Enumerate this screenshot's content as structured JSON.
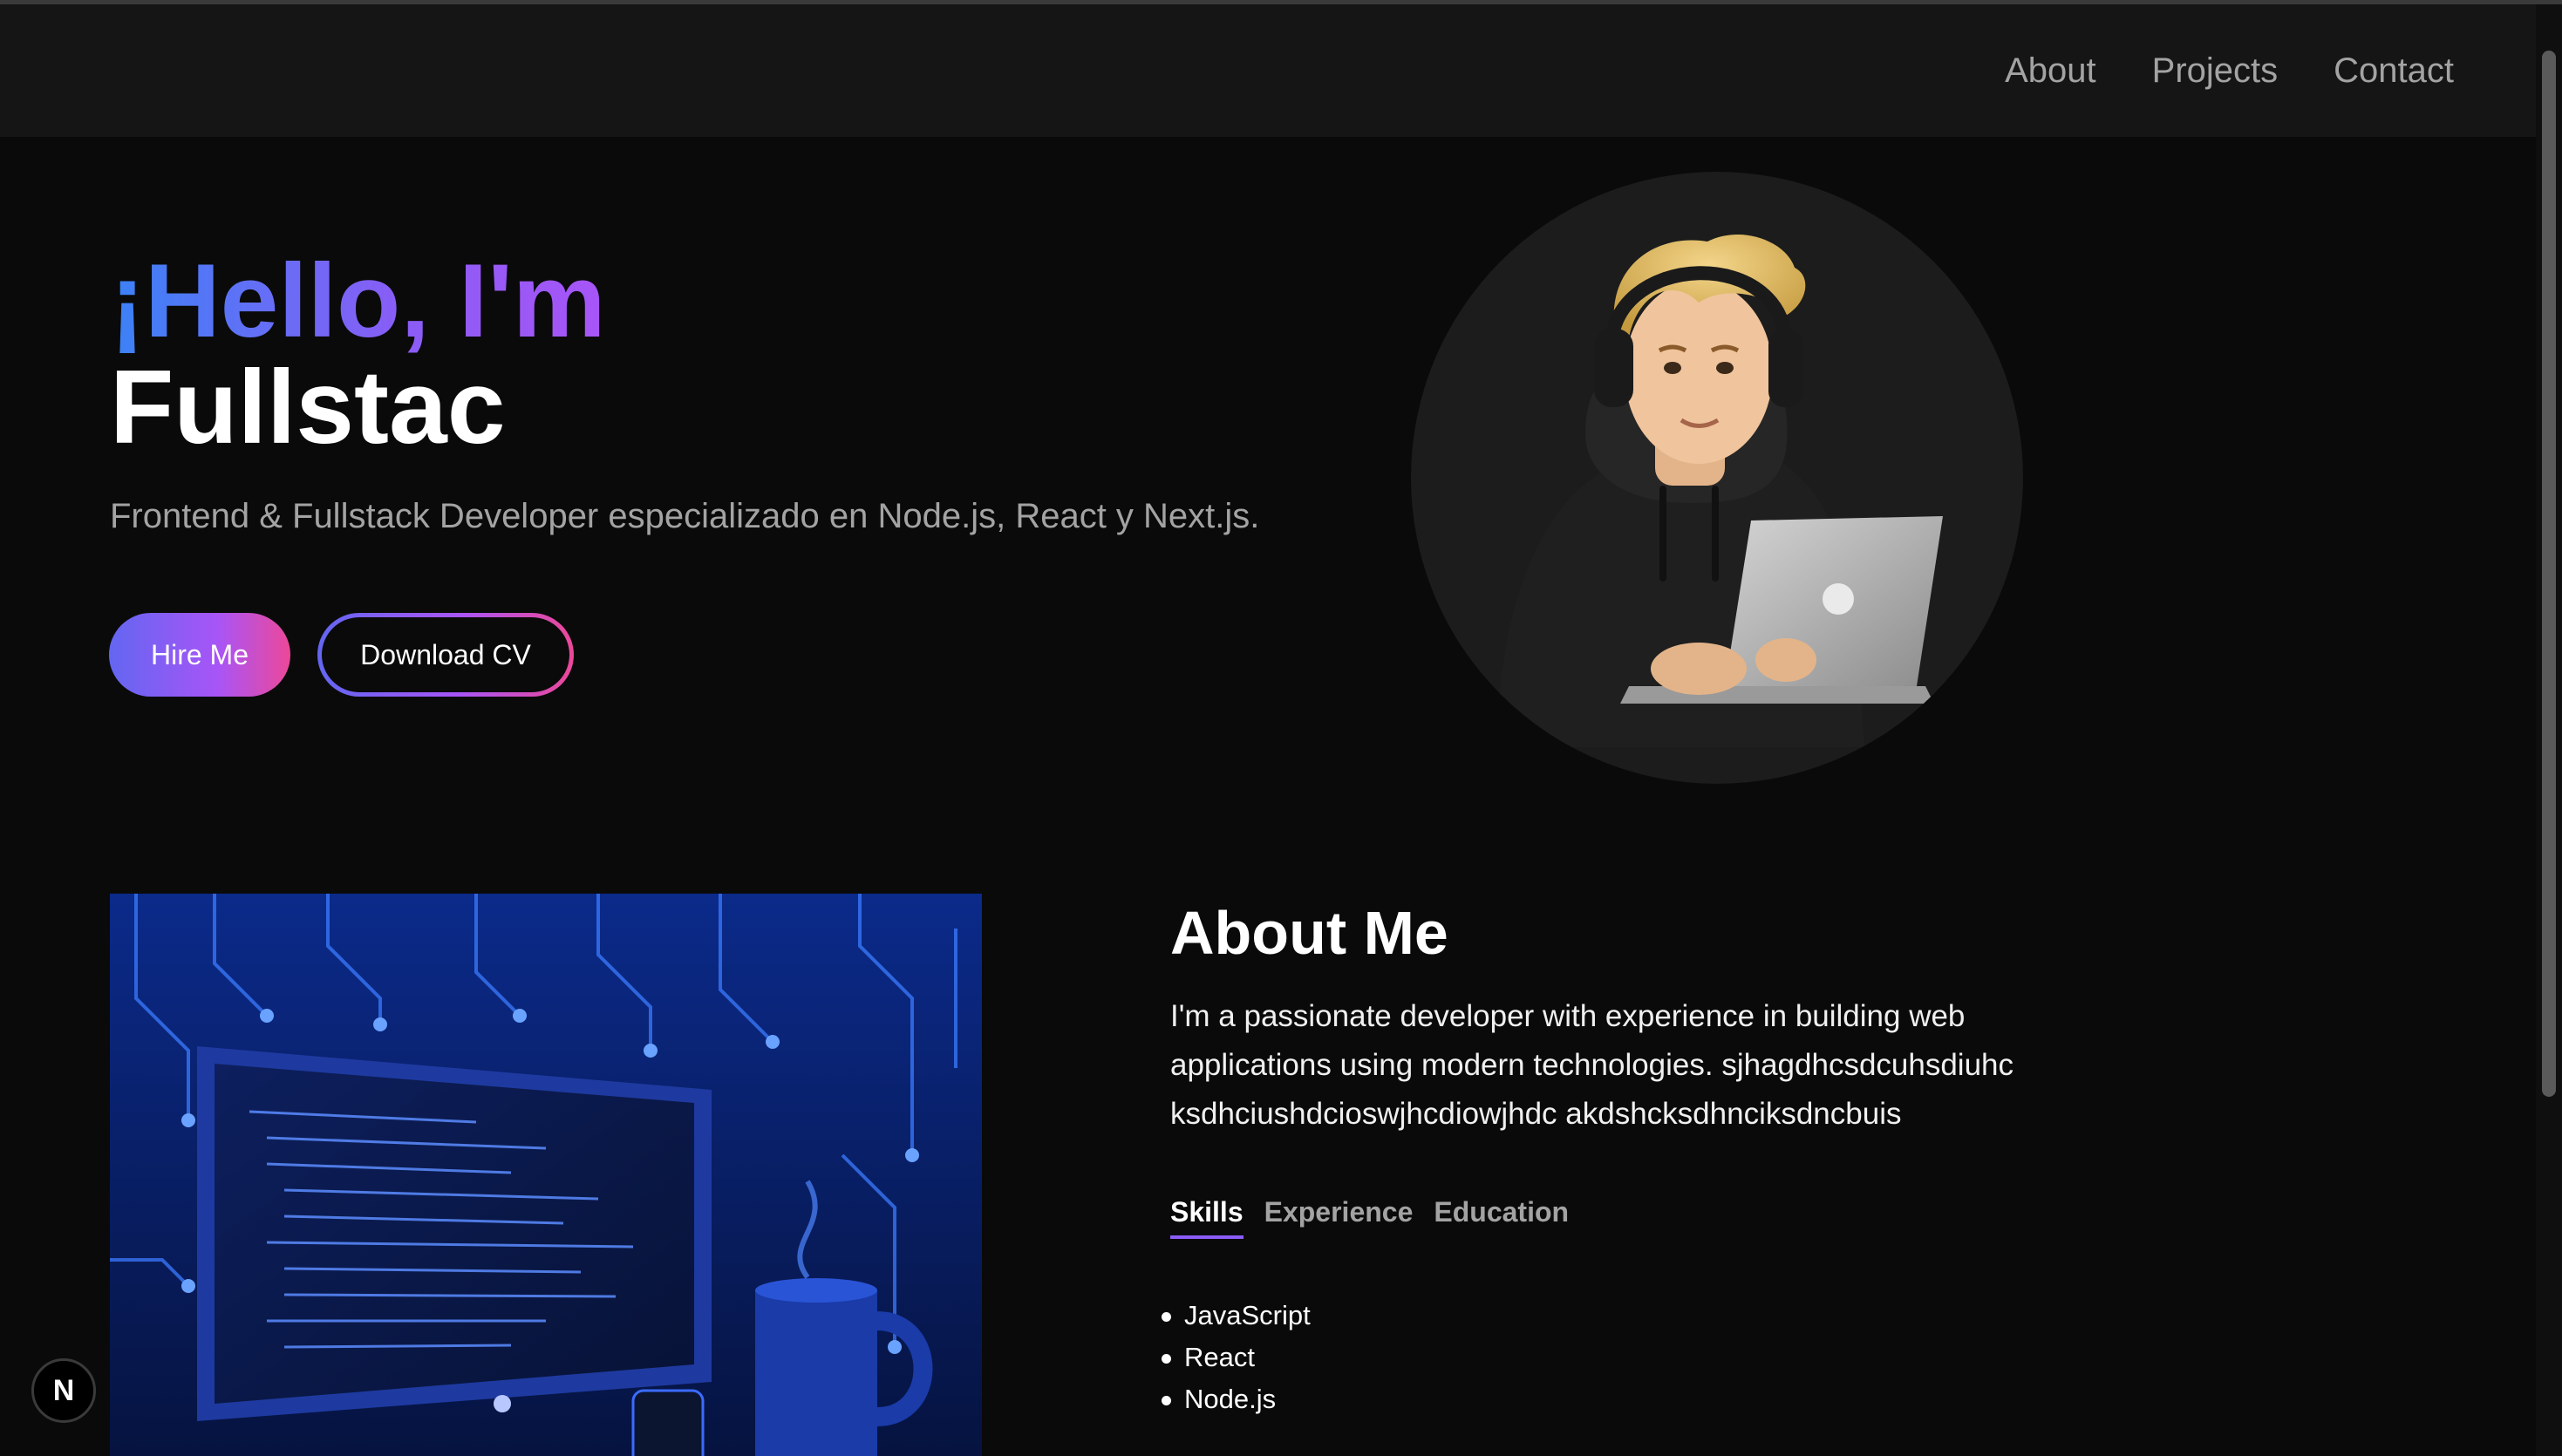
{
  "nav": {
    "items": [
      {
        "label": "About"
      },
      {
        "label": "Projects"
      },
      {
        "label": "Contact"
      }
    ]
  },
  "hero": {
    "greeting": "¡Hello, I'm",
    "role": "Fullstac",
    "subtitle": "Frontend & Fullstack Developer especializado en Node.js, React y Next.js.",
    "hire_button": "Hire Me",
    "cv_button": "Download CV"
  },
  "about": {
    "title": "About Me",
    "text": "I'm a passionate developer with experience in building web applications using modern technologies. sjhagdhcsdcuhsdiuhc ksdhciushdcioswjhcdiowjhdc akdshcksdhnciksdncbuis",
    "tabs": [
      {
        "label": "Skills",
        "active": true
      },
      {
        "label": "Experience",
        "active": false
      },
      {
        "label": "Education",
        "active": false
      }
    ],
    "skills": [
      "JavaScript",
      "React",
      "Node.js"
    ]
  },
  "badge": {
    "label": "N"
  },
  "colors": {
    "background": "#0a0a0a",
    "navbar": "#151515",
    "accent_blue": "#3b82f6",
    "accent_purple": "#8b5cf6",
    "accent_pink": "#ec4899",
    "muted_text": "#a3a3a3"
  },
  "icons": {
    "avatar": "developer-with-laptop-illustration",
    "about_image": "computer-with-code-illustration",
    "badge": "nextjs-logo-icon"
  }
}
